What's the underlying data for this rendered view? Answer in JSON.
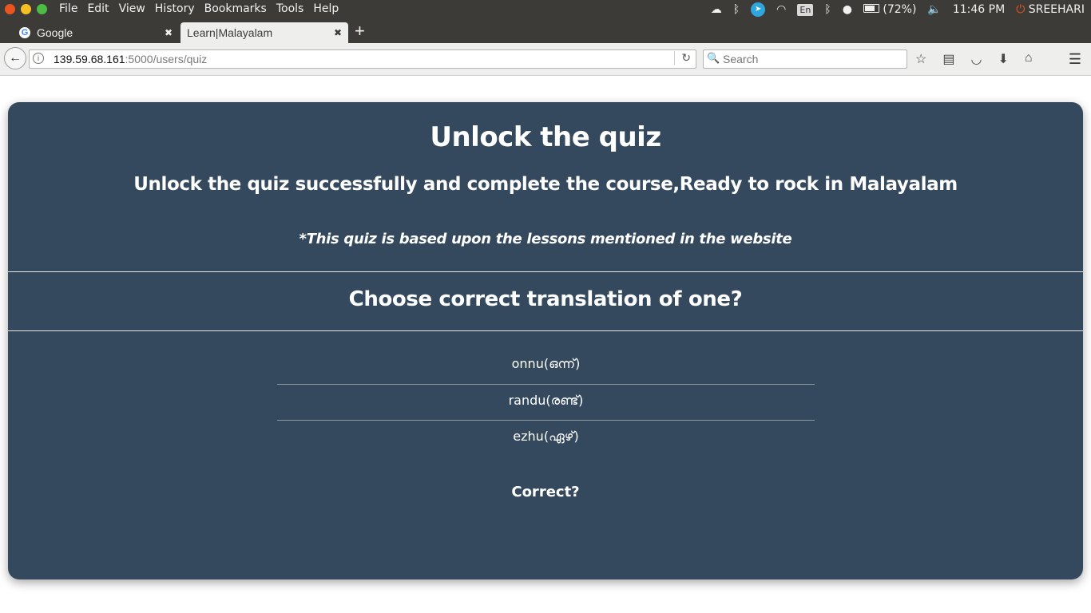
{
  "system": {
    "menu": [
      "File",
      "Edit",
      "View",
      "History",
      "Bookmarks",
      "Tools",
      "Help"
    ],
    "battery": "(72%)",
    "clock": "11:46 PM",
    "user": "SREEHARI",
    "keyboard": "En"
  },
  "tabs": [
    {
      "label": "Google",
      "icon": "google-icon"
    },
    {
      "label": "Learn|Malayalam",
      "active": true
    }
  ],
  "nav": {
    "url_host": "139.59.68.161",
    "url_path": ":5000/users/quiz",
    "search_placeholder": "Search"
  },
  "page": {
    "title": "Unlock the quiz",
    "subtitle": "Unlock the quiz successfully and complete the course,Ready to rock in Malayalam",
    "note": "*This quiz is based upon the lessons mentioned in the website",
    "question": "Choose correct translation of one?",
    "options": [
      "onnu(ഒന്ന്)",
      "randu(രണ്ട്)",
      "ezhu(ഏഴ്)"
    ],
    "result": "Correct?"
  },
  "colors": {
    "card_bg": "#34495e",
    "chrome_dark": "#3c3b37",
    "accent_close": "#e95420"
  }
}
